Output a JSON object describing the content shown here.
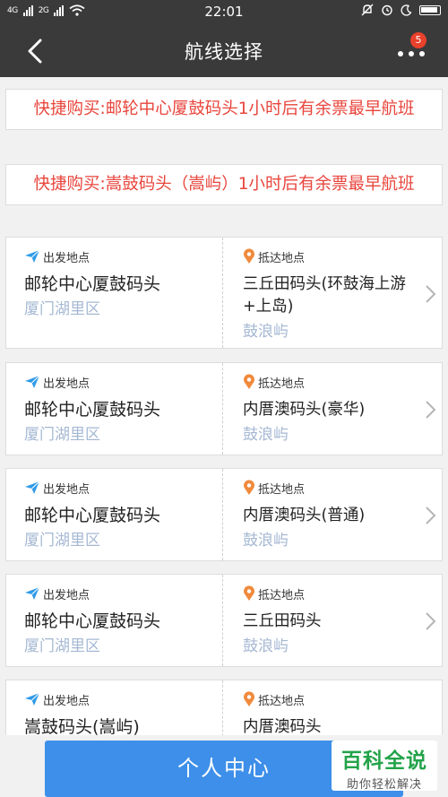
{
  "status": {
    "network1": "4G",
    "network2": "2G",
    "time": "22:01"
  },
  "nav": {
    "title": "航线选择",
    "back_icon": "‹",
    "badge": "5"
  },
  "quick_buy": [
    {
      "text": "快捷购买:邮轮中心厦鼓码头1小时后有余票最早航班"
    },
    {
      "text": "快捷购买:嵩鼓码头（嵩屿）1小时后有余票最早航班"
    }
  ],
  "routes": [
    {
      "depart_label": "出发地点",
      "depart_name": "邮轮中心厦鼓码头",
      "depart_area": "厦门湖里区",
      "arrive_label": "抵达地点",
      "arrive_name": "三丘田码头(环鼓海上游+上岛)",
      "arrive_area": "鼓浪屿"
    },
    {
      "depart_label": "出发地点",
      "depart_name": "邮轮中心厦鼓码头",
      "depart_area": "厦门湖里区",
      "arrive_label": "抵达地点",
      "arrive_name": "内厝澳码头(豪华)",
      "arrive_area": "鼓浪屿"
    },
    {
      "depart_label": "出发地点",
      "depart_name": "邮轮中心厦鼓码头",
      "depart_area": "厦门湖里区",
      "arrive_label": "抵达地点",
      "arrive_name": "内厝澳码头(普通)",
      "arrive_area": "鼓浪屿"
    },
    {
      "depart_label": "出发地点",
      "depart_name": "邮轮中心厦鼓码头",
      "depart_area": "厦门湖里区",
      "arrive_label": "抵达地点",
      "arrive_name": "三丘田码头",
      "arrive_area": "鼓浪屿"
    },
    {
      "depart_label": "出发地点",
      "depart_name": "嵩鼓码头(嵩屿)",
      "depart_area": "",
      "arrive_label": "抵达地点",
      "arrive_name": "内厝澳码头",
      "arrive_area": ""
    }
  ],
  "bottom": {
    "center_button": "个人中心"
  },
  "watermark": {
    "title": "百科全说",
    "subtitle": "助你轻松解决"
  },
  "colors": {
    "header_bg": "#3a3a3a",
    "quick_text": "#e8453c",
    "area_text": "#a5b8d3",
    "primary_button": "#3d8fe9",
    "plane_icon": "#2f9be8",
    "pin_icon": "#f08a3c",
    "badge": "#e8412c"
  }
}
